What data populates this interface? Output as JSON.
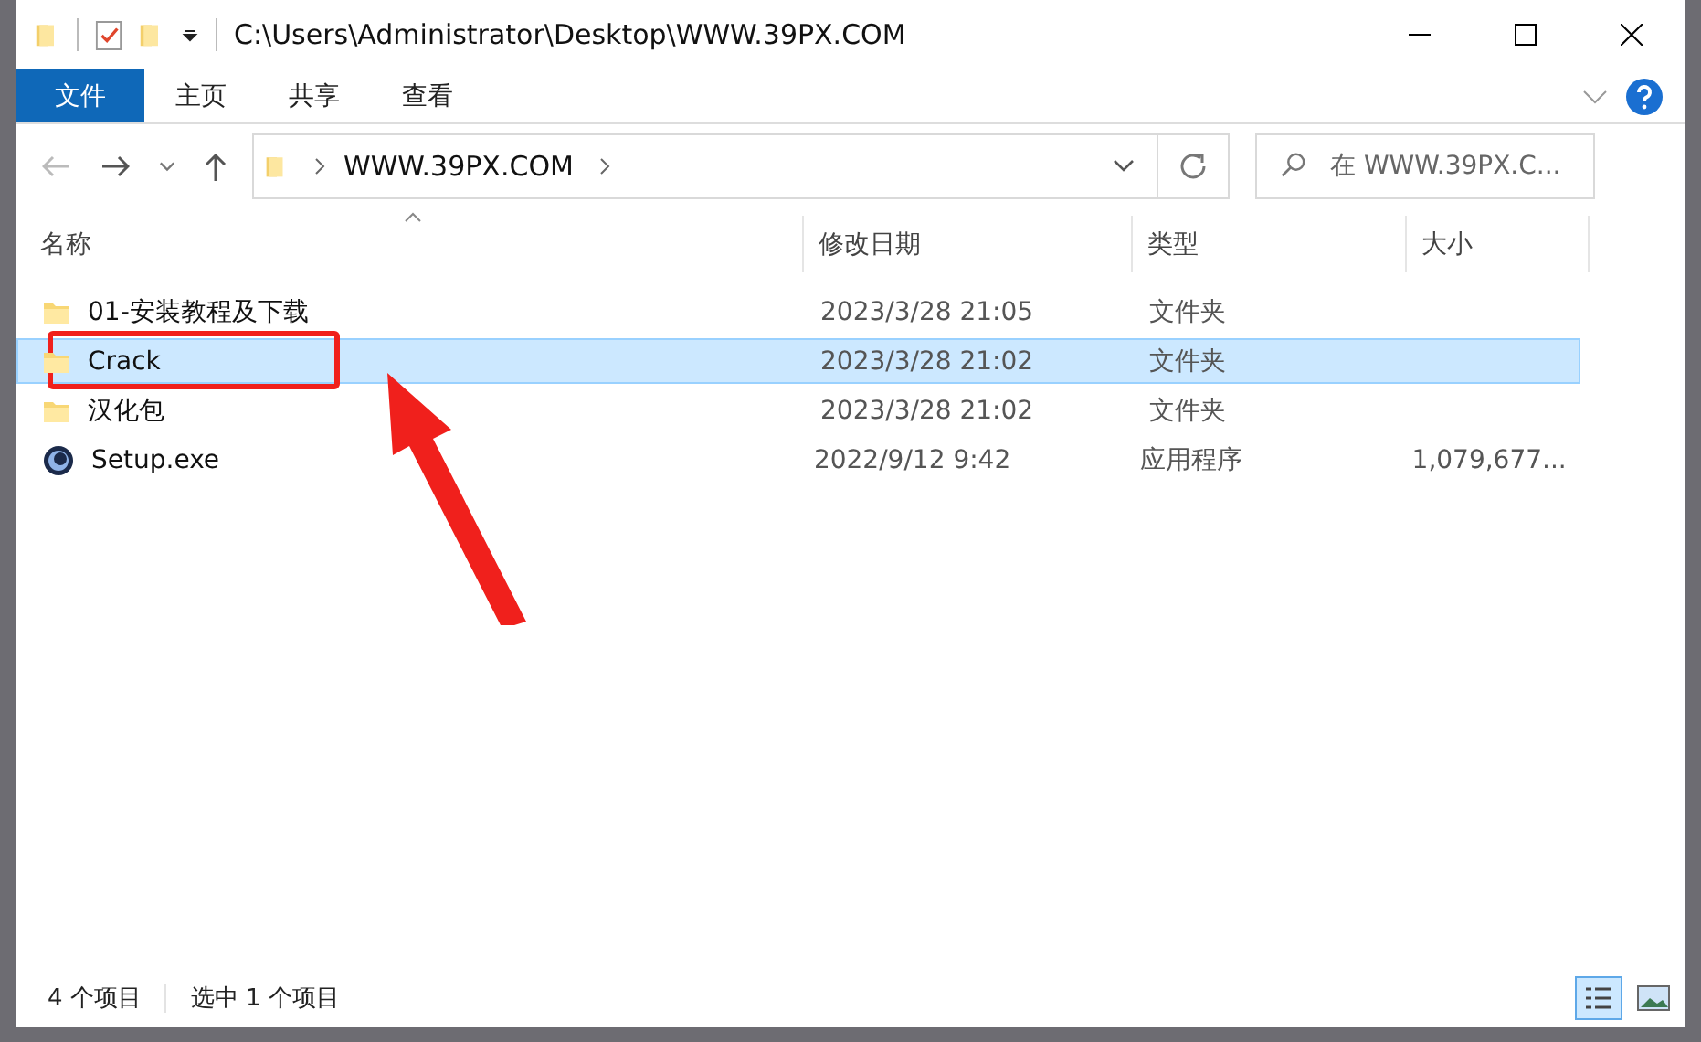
{
  "window": {
    "path": "C:\\Users\\Administrator\\Desktop\\WWW.39PX.COM"
  },
  "ribbon_tabs": [
    {
      "label": "文件",
      "kind": "file"
    },
    {
      "label": "主页",
      "kind": "tab"
    },
    {
      "label": "共享",
      "kind": "tab"
    },
    {
      "label": "查看",
      "kind": "tab"
    }
  ],
  "address_bar": {
    "breadcrumbs": [
      "WWW.39PX.COM"
    ]
  },
  "search": {
    "placeholder": "在 WWW.39PX.C..."
  },
  "columns": [
    {
      "label": "名称",
      "sorted": true
    },
    {
      "label": "修改日期",
      "sorted": false
    },
    {
      "label": "类型",
      "sorted": false
    },
    {
      "label": "大小",
      "sorted": false
    }
  ],
  "rows": [
    {
      "kind": "folder",
      "name": "01-安装教程及下载",
      "date": "2023/3/28 21:05",
      "type": "文件夹",
      "selected": false,
      "annotated": false
    },
    {
      "kind": "folder",
      "name": "Crack",
      "date": "2023/3/28 21:02",
      "type": "文件夹",
      "selected": true,
      "annotated": true
    },
    {
      "kind": "folder",
      "name": "汉化包",
      "date": "2023/3/28 21:02",
      "type": "文件夹",
      "selected": false,
      "annotated": false
    },
    {
      "kind": "app",
      "name": "Setup.exe",
      "date": "2022/9/12 9:42",
      "type": "应用程序",
      "size": "1,079,677...",
      "selected": false,
      "annotated": false
    }
  ],
  "status_bar": {
    "item_count": "4 个项目",
    "selection": "选中 1 个项目",
    "views": [
      {
        "kind": "details",
        "selected": true
      },
      {
        "kind": "large-icons",
        "selected": false
      }
    ]
  }
}
